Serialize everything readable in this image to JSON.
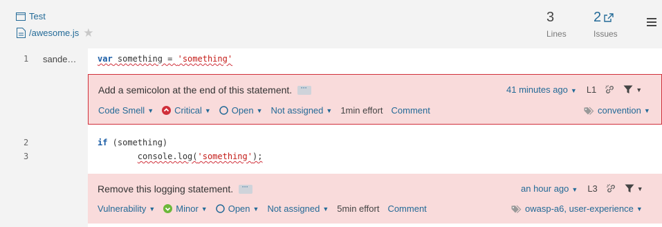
{
  "header": {
    "project": "Test",
    "file": "/awesome.js",
    "measures": [
      {
        "value": "3",
        "label": "Lines"
      },
      {
        "value": "2",
        "label": "Issues"
      }
    ]
  },
  "lines": [
    {
      "number": "1",
      "author": "sande…",
      "code": "var something = 'something'"
    },
    {
      "number": "2",
      "author": "",
      "code": "if (something)"
    },
    {
      "number": "3",
      "author": "",
      "code": "        console.log('something');"
    }
  ],
  "issues": [
    {
      "message": "Add a semicolon at the end of this statement.",
      "type": "Code Smell",
      "severity": "Critical",
      "status": "Open",
      "assignee": "Not assigned",
      "effort": "1min effort",
      "comment": "Comment",
      "age": "41 minutes ago",
      "line": "L1",
      "tags": "convention"
    },
    {
      "message": "Remove this logging statement.",
      "type": "Vulnerability",
      "severity": "Minor",
      "status": "Open",
      "assignee": "Not assigned",
      "effort": "5min effort",
      "comment": "Comment",
      "age": "an hour ago",
      "line": "L3",
      "tags": "owasp-a6, user-experience"
    }
  ],
  "colors": {
    "link": "#236a97",
    "issue_bg": "#f9dbdb",
    "critical": "#d02f3a",
    "minor": "#6cb83a"
  }
}
